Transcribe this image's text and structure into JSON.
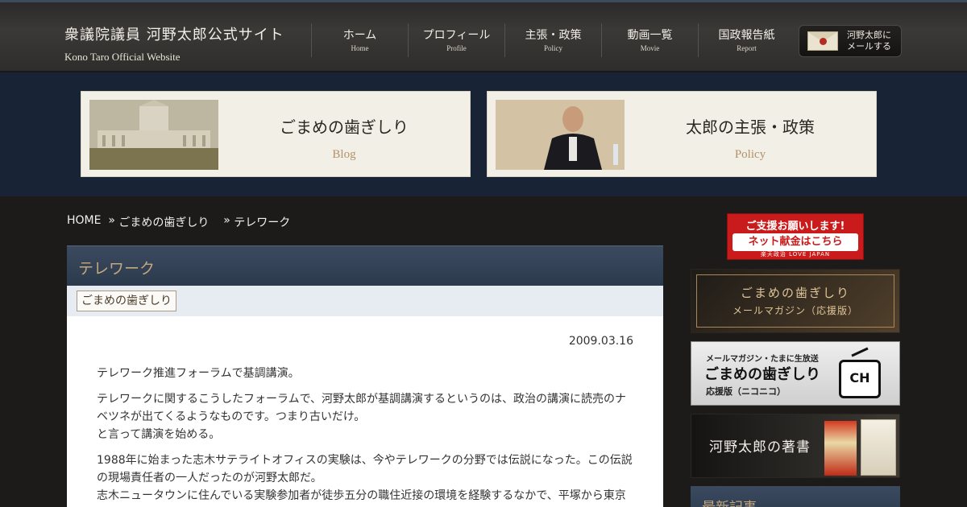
{
  "header": {
    "site_title": "衆議院議員 河野太郎公式サイト",
    "site_subtitle": "Kono Taro Official Website",
    "nav": [
      {
        "label": "ホーム",
        "sub": "Home"
      },
      {
        "label": "プロフィール",
        "sub": "Profile"
      },
      {
        "label": "主張・政策",
        "sub": "Policy"
      },
      {
        "label": "動画一覧",
        "sub": "Movie"
      },
      {
        "label": "国政報告紙",
        "sub": "Report"
      }
    ],
    "mail_button": {
      "line1": "河野太郎に",
      "line2": "メールする",
      "icon": "envelope-icon"
    }
  },
  "feature_cards": [
    {
      "title": "ごまめの歯ぎしり",
      "sub": "Blog"
    },
    {
      "title": "太郎の主張・政策",
      "sub": "Policy"
    }
  ],
  "breadcrumb": {
    "home": "HOME",
    "sep1": "»",
    "blog": "ごまめの歯ぎしり",
    "sep2": "»",
    "current": "テレワーク"
  },
  "post": {
    "title": "テレワーク",
    "category": "ごまめの歯ぎしり",
    "date": "2009.03.16",
    "paragraphs": [
      "テレワーク推進フォーラムで基調講演。",
      "テレワークに関するこうしたフォーラムで、河野太郎が基調講演するというのは、政治の講演に読売のナベツネが出てくるようなものです。つまり古いだけ。",
      "と言って講演を始める。",
      "1988年に始まった志木サテライトオフィスの実験は、今やテレワークの分野では伝説になった。この伝説の現場責任者の一人だったのが河野太郎だ。",
      "志木ニュータウンに住んでいる実験参加者が徒歩五分の職住近接の環境を経験するなかで、平塚から東京"
    ]
  },
  "sidebar": {
    "donate": {
      "line1": "ご支援お願いします!",
      "line2": "ネット献金はこちら",
      "line3": "楽天政治 LOVE JAPAN"
    },
    "mag_banner": {
      "line1": "ごまめの歯ぎしり",
      "line2": "メールマガジン（応援版）"
    },
    "nico_banner": {
      "line1": "メールマガジン・たまに生放送",
      "line2": "ごまめの歯ぎしり",
      "line3": "応援版（ニコニコ）",
      "icon_text": "CH"
    },
    "books_banner": {
      "label": "河野太郎の著書"
    },
    "latest_heading": "最新記事"
  },
  "colors": {
    "band_bg": "#182335",
    "accent_gold": "#c4a77a",
    "donate_red": "#c91b1b"
  }
}
